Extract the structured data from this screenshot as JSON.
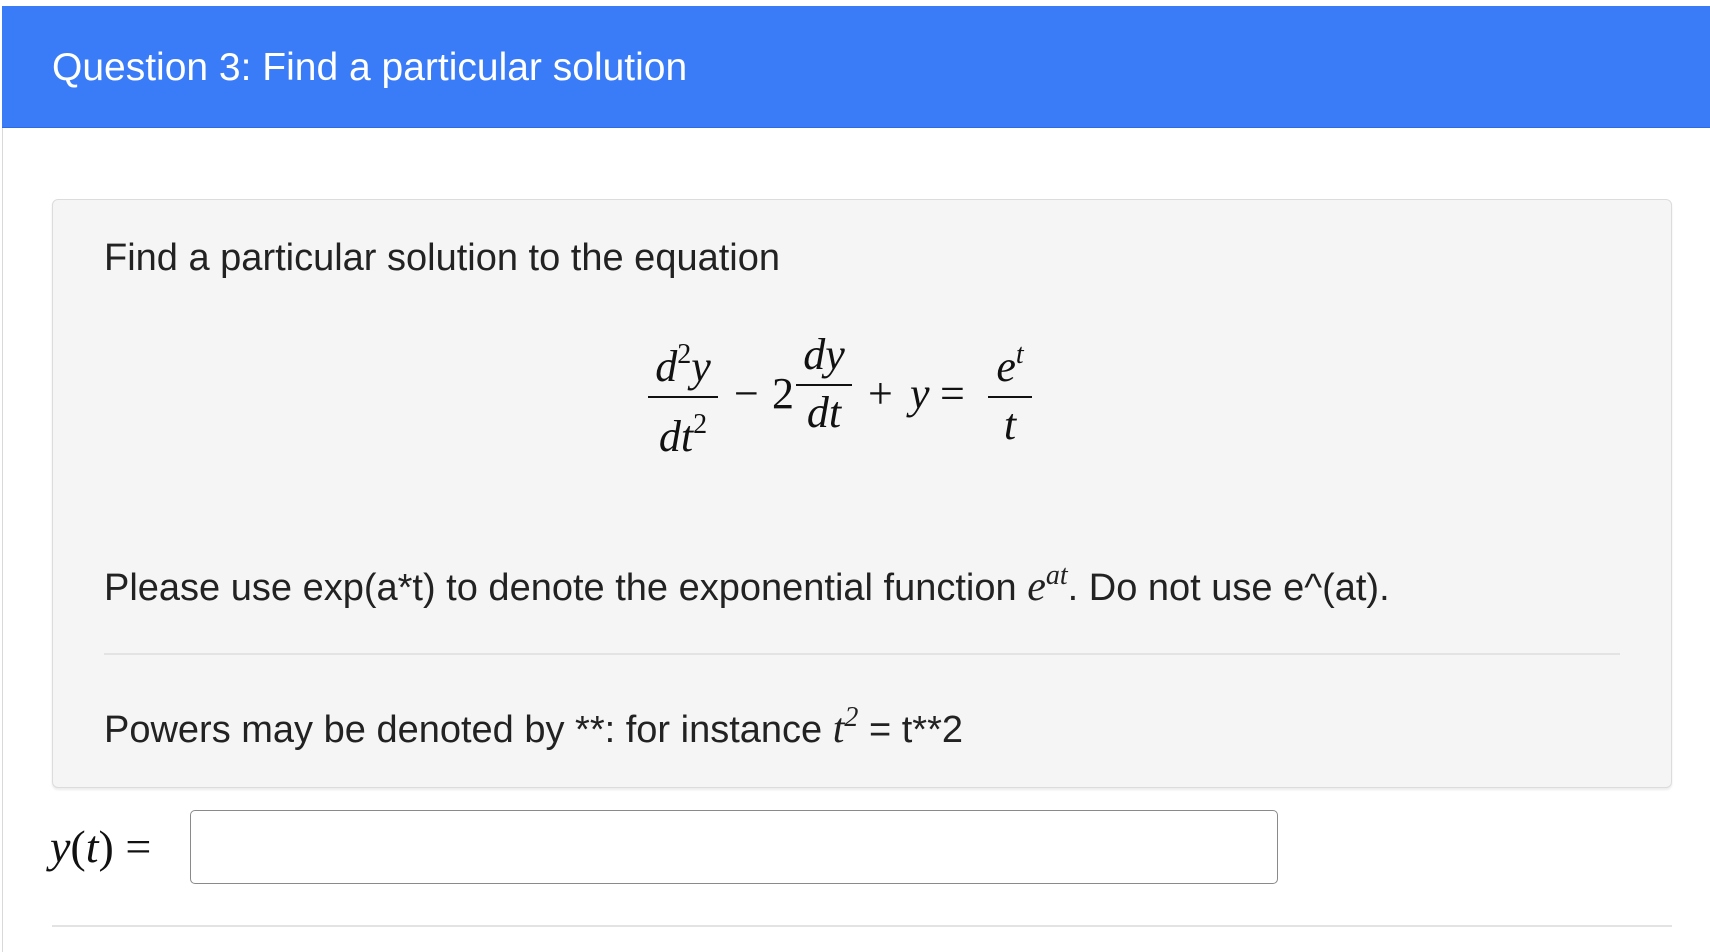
{
  "header": {
    "title": "Question 3: Find a particular solution"
  },
  "question": {
    "prompt": "Find a particular solution to the equation",
    "equation": {
      "term1_num_d": "d",
      "term1_num_sup": "2",
      "term1_num_y": "y",
      "term1_den_dt": "dt",
      "term1_den_sup": "2",
      "minus": "−",
      "coef": "2",
      "term2_num": "dy",
      "term2_den": "dt",
      "plus": "+",
      "y": "y",
      "equals": "=",
      "rhs_num_e": "e",
      "rhs_num_sup": "t",
      "rhs_den": "t"
    },
    "instruction_before": "Please use exp(a*t) to denote the exponential function ",
    "instruction_math_base": "e",
    "instruction_math_sup": "at",
    "instruction_after": ". Do not use e^(at).",
    "powers_before": "Powers may be denoted by **: for instance ",
    "powers_math_base": "t",
    "powers_math_sup": "2",
    "powers_after": " = t**2"
  },
  "answer": {
    "label_y": "y",
    "label_paren_open": "(",
    "label_t": "t",
    "label_paren_close": ")",
    "label_equals": "=",
    "input_value": ""
  },
  "colors": {
    "header_bg": "#3a7cf7",
    "panel_bg": "#f5f5f5"
  }
}
